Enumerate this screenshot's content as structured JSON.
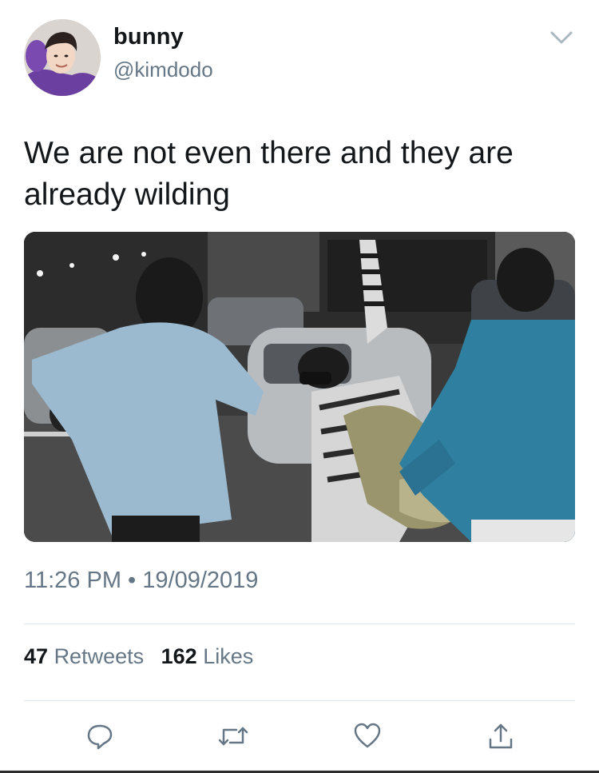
{
  "user": {
    "display_name": "bunny",
    "handle": "@kimdodo"
  },
  "tweet": {
    "text": "We are not even there and they are already wilding",
    "time": "11:26 PM",
    "separator": "•",
    "date": "19/09/2019"
  },
  "stats": {
    "retweets_count": "47",
    "retweets_label": "Retweets",
    "likes_count": "162",
    "likes_label": "Likes"
  },
  "icons": {
    "menu": "chevron-down-icon",
    "reply": "reply-icon",
    "retweet": "retweet-icon",
    "like": "heart-icon",
    "share": "share-icon"
  },
  "colors": {
    "text_primary": "#14171a",
    "text_secondary": "#657786",
    "divider": "#e1e8ed"
  }
}
